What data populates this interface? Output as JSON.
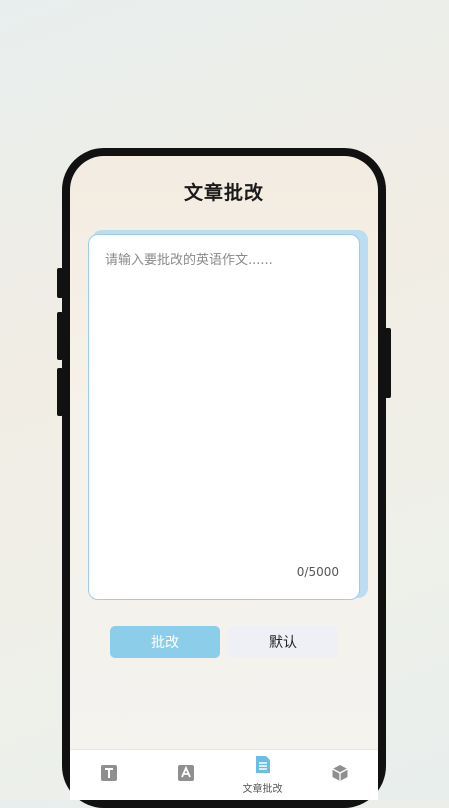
{
  "page": {
    "title": "文章批改"
  },
  "editor": {
    "placeholder": "请输入要批改的英语作文......",
    "value": "",
    "counter": "0/5000"
  },
  "actions": {
    "submit_label": "批改",
    "default_label": "默认"
  },
  "tabbar": {
    "items": [
      {
        "icon": "text-icon",
        "label": ""
      },
      {
        "icon": "pen-icon",
        "label": ""
      },
      {
        "icon": "document-icon",
        "label": "文章批改",
        "active": true
      },
      {
        "icon": "cube-icon",
        "label": ""
      }
    ]
  },
  "colors": {
    "accent": "#8ccdea",
    "tab_active": "#6bbde3",
    "tab_inactive": "#8f8f8f"
  }
}
